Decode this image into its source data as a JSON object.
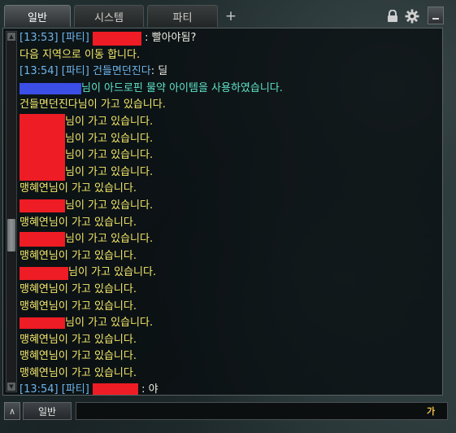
{
  "tabs": [
    {
      "label": "일반",
      "active": true
    },
    {
      "label": "시스템",
      "active": false
    },
    {
      "label": "파티",
      "active": false
    }
  ],
  "tab_add_label": "+",
  "window_controls": {
    "lock_icon": "lock-icon",
    "settings_icon": "gear-icon",
    "minimize_icon": "minimize-icon"
  },
  "messages": [
    {
      "type": "party",
      "time": "[13:53]",
      "channel": "[파티]",
      "sender_redacted": true,
      "text": ": 빨아야됨?"
    },
    {
      "type": "system",
      "text": "다음 지역으로 이동 합니다."
    },
    {
      "type": "party",
      "time": "[13:54]",
      "channel": "[파티]",
      "sender": "건들면던진다",
      "text": " : 딜"
    },
    {
      "type": "item",
      "name_redacted": "blue",
      "text": "님이 아드로핀 물약 아이템을 사용하였습니다."
    },
    {
      "type": "move",
      "name": "건들면던진다",
      "text": "님이 가고 있습니다."
    },
    {
      "type": "move",
      "name_redacted": "red",
      "text": "님이 가고 있습니다."
    },
    {
      "type": "move",
      "name_redacted": "red",
      "text": "님이 가고 있습니다."
    },
    {
      "type": "move",
      "name_redacted": "red",
      "text": "님이 가고 있습니다."
    },
    {
      "type": "move",
      "name_redacted": "red",
      "text": "님이 가고 있습니다."
    },
    {
      "type": "move",
      "name": "맹혜연",
      "text": "님이 가고 있습니다."
    },
    {
      "type": "move",
      "name_redacted": "red",
      "text": "님이 가고 있습니다."
    },
    {
      "type": "move",
      "name": "맹혜연",
      "text": "님이 가고 있습니다."
    },
    {
      "type": "move",
      "name_redacted": "red",
      "text": "님이 가고 있습니다."
    },
    {
      "type": "move",
      "name": "맹혜연",
      "text": "님이 가고 있습니다."
    },
    {
      "type": "move",
      "name_redacted": "red",
      "text": "님이 가고 있습니다."
    },
    {
      "type": "move",
      "name": "맹혜연",
      "text": "님이 가고 있습니다."
    },
    {
      "type": "move",
      "name": "맹혜연",
      "text": "님이 가고 있습니다."
    },
    {
      "type": "move",
      "name_redacted": "red",
      "text": "님이 가고 있습니다."
    },
    {
      "type": "move",
      "name": "맹혜연",
      "text": "님이 가고 있습니다."
    },
    {
      "type": "move",
      "name": "맹혜연",
      "text": "님이 가고 있습니다."
    },
    {
      "type": "move",
      "name": "맹혜연",
      "text": "님이 가고 있습니다."
    },
    {
      "type": "party",
      "time": "[13:54]",
      "channel": "[파티]",
      "sender_redacted": true,
      "text": ": 야"
    }
  ],
  "input": {
    "toggle_label": "∧",
    "channel_label": "일반",
    "value": "",
    "ime_indicator": "가"
  },
  "colors": {
    "system_text": "#f3e76a",
    "party_text": "#6fb4ea",
    "item_text": "#5fe4c9",
    "redaction_red": "#ee1c24",
    "redaction_blue": "#3b4ee6"
  }
}
